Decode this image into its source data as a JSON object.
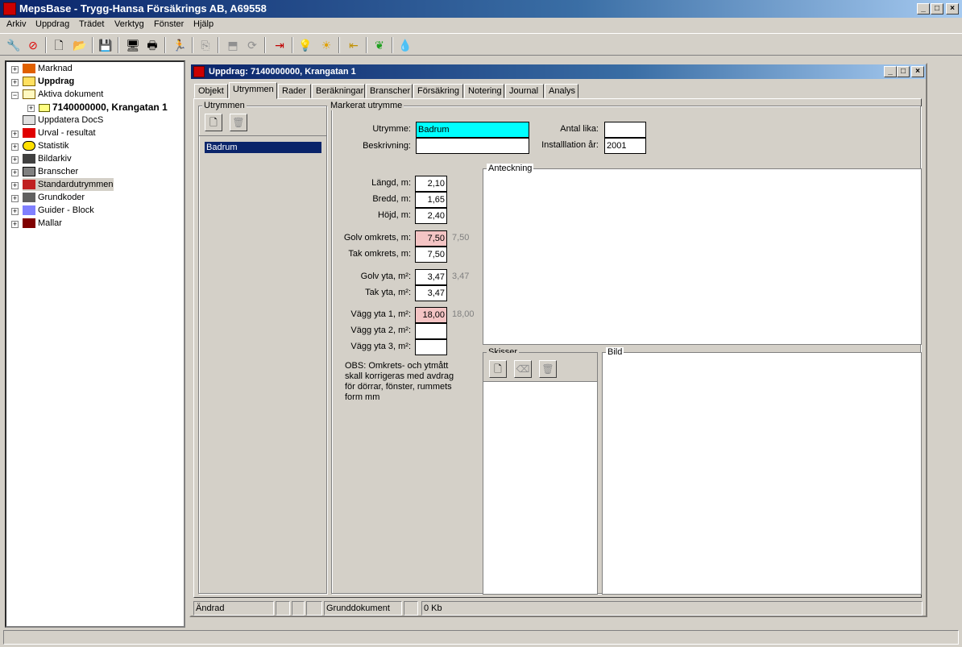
{
  "app": {
    "title": "MepsBase - Trygg-Hansa Försäkrings AB, A69558"
  },
  "menu": [
    "Arkiv",
    "Uppdrag",
    "Trädet",
    "Verktyg",
    "Fönster",
    "Hjälp"
  ],
  "tree": {
    "items": [
      {
        "label": "Marknad"
      },
      {
        "label": "Uppdrag"
      },
      {
        "label": "Aktiva dokument"
      },
      {
        "label": "7140000000, Krangatan 1"
      },
      {
        "label": "Uppdatera DocS"
      },
      {
        "label": "Urval - resultat"
      },
      {
        "label": "Statistik"
      },
      {
        "label": "Bildarkiv"
      },
      {
        "label": "Branscher"
      },
      {
        "label": "Standardutrymmen"
      },
      {
        "label": "Grundkoder"
      },
      {
        "label": "Guider - Block"
      },
      {
        "label": "Mallar"
      }
    ]
  },
  "child": {
    "title": "Uppdrag: 7140000000, Krangatan 1",
    "tabs": [
      "Objekt",
      "Utrymmen",
      "Rader",
      "Beräkningar",
      "Branscher",
      "Försäkring",
      "Notering",
      "Journal",
      "Analys"
    ]
  },
  "utrymmen": {
    "group_label": "Utrymmen",
    "list": [
      "Badrum"
    ]
  },
  "markerat": {
    "group_label": "Markerat utrymme",
    "utrymme_label": "Utrymme:",
    "utrymme_value": "Badrum",
    "beskrivning_label": "Beskrivning:",
    "beskrivning_value": "",
    "antal_label": "Antal lika:",
    "antal_value": "",
    "install_label": "Installlation år:",
    "install_value": "2001",
    "langd_label": "Längd, m:",
    "langd_value": "2,10",
    "bredd_label": "Bredd, m:",
    "bredd_value": "1,65",
    "hojd_label": "Höjd, m:",
    "hojd_value": "2,40",
    "golvomk_label": "Golv omkrets, m:",
    "golvomk_value": "7,50",
    "golvomk_calc": "7,50",
    "takomk_label": "Tak omkrets, m:",
    "takomk_value": "7,50",
    "golvyta_label": "Golv yta, m²:",
    "golvyta_value": "3,47",
    "golvyta_calc": "3,47",
    "takyta_label": "Tak yta, m²:",
    "takyta_value": "3,47",
    "vagg1_label": "Vägg yta 1, m²:",
    "vagg1_value": "18,00",
    "vagg1_calc": "18,00",
    "vagg2_label": "Vägg yta 2, m²:",
    "vagg2_value": "",
    "vagg3_label": "Vägg yta 3, m²:",
    "vagg3_value": "",
    "obs": "OBS: Omkrets- och ytmått skall korrigeras med avdrag för dörrar, fönster, rummets form mm",
    "anteckning_label": "Anteckning",
    "skisser_label": "Skisser",
    "bild_label": "Bild"
  },
  "statusbar": {
    "status": "Ändrad",
    "doc": "Grunddokument",
    "size": "0 Kb"
  },
  "colors": {
    "title": "#0a246a",
    "selection": "#0a246a",
    "pink": "#f4c4c4",
    "cyan": "#00ffff"
  }
}
